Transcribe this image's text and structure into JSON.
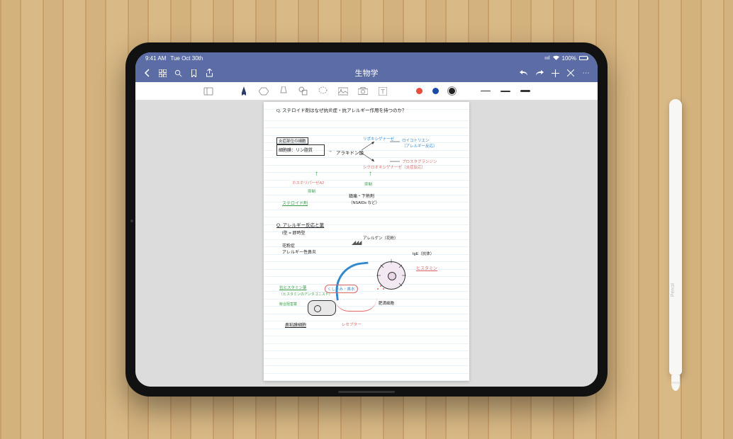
{
  "status": {
    "time": "9:41 AM",
    "date": "Tue Oct 30th",
    "signal": "••ııl",
    "wifi": "⬡",
    "battery_pct": "100%"
  },
  "nav": {
    "title": "生物学"
  },
  "toolbar": {
    "colors": {
      "red": "#e74c3c",
      "blue": "#1a4ba8",
      "black": "#222222"
    }
  },
  "pencil_label": " Pencil",
  "notes": {
    "q1": "Q. ステロイド剤はなぜ抗炎症・抗アレルギー作用を持つのか？",
    "box_label": "炎症部位の細胞",
    "box1": "細胞膜：リン脂質",
    "arachidon": "アラキドン酸",
    "lipooxy": "リポキシゲナーゼ",
    "leuko": "ロイコトリエン",
    "allergy_note": "（アレルギー反応）",
    "cyclooxy": "シクロオキシゲナーゼ",
    "prostaglandin": "プロスタグランジン",
    "inflammation_note": "（炎症反応）",
    "phospholipase": "ホスホリパーゼA2",
    "yokusei": "抑制",
    "steroid": "ステロイド剤",
    "nsaids_line1": "鎮痛・下熱剤",
    "nsaids_line2": "（NSAIDs など）",
    "q2": "Q. アレルギー反応と薬",
    "type1": "I型 = 即時型",
    "hayfever": "花粉症\nアレルギー性鼻炎",
    "allergen": "アレルゲン（花粉）",
    "ige": "IgE（抗体）",
    "histamine": "ヒスタミン",
    "mast_cell_label": "肥満細胞",
    "antihistamine": "抗ヒスタミン薬",
    "antagonist": "（ヒスタミンのアンタゴニスト）",
    "tissue_cell": "競合阻害薬",
    "mucosa": "鼻粘膜細胞",
    "receptor": "レセプター",
    "sneeze": "くしゃみ・鼻水"
  }
}
